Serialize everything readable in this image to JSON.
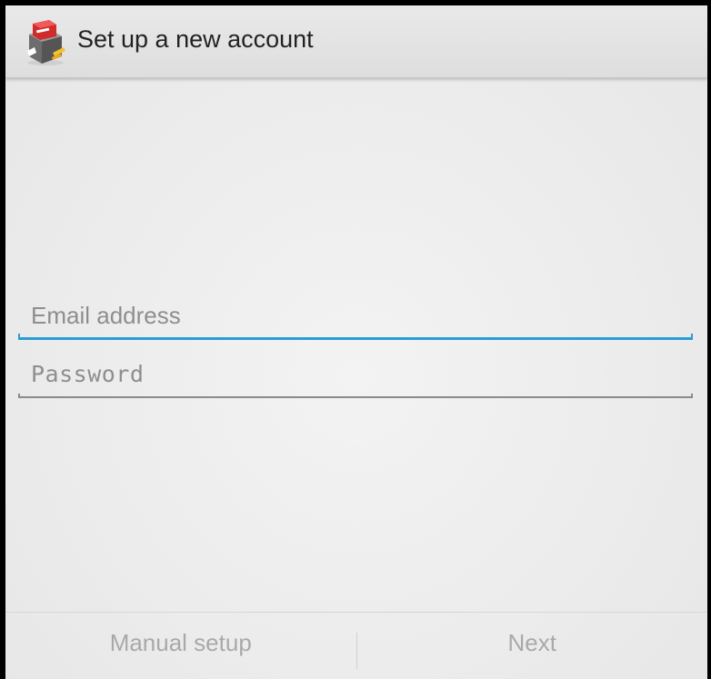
{
  "action_bar": {
    "title": "Set up a new account",
    "icon": "email-app-icon"
  },
  "form": {
    "email": {
      "value": "",
      "placeholder": "Email address",
      "focused": true
    },
    "password": {
      "value": "",
      "placeholder": "Password"
    }
  },
  "buttons": {
    "manual_setup": "Manual setup",
    "next": "Next"
  },
  "colors": {
    "focus_accent": "#2a9dd6",
    "disabled_text": "#a9a9a9",
    "background": "#ececec"
  }
}
